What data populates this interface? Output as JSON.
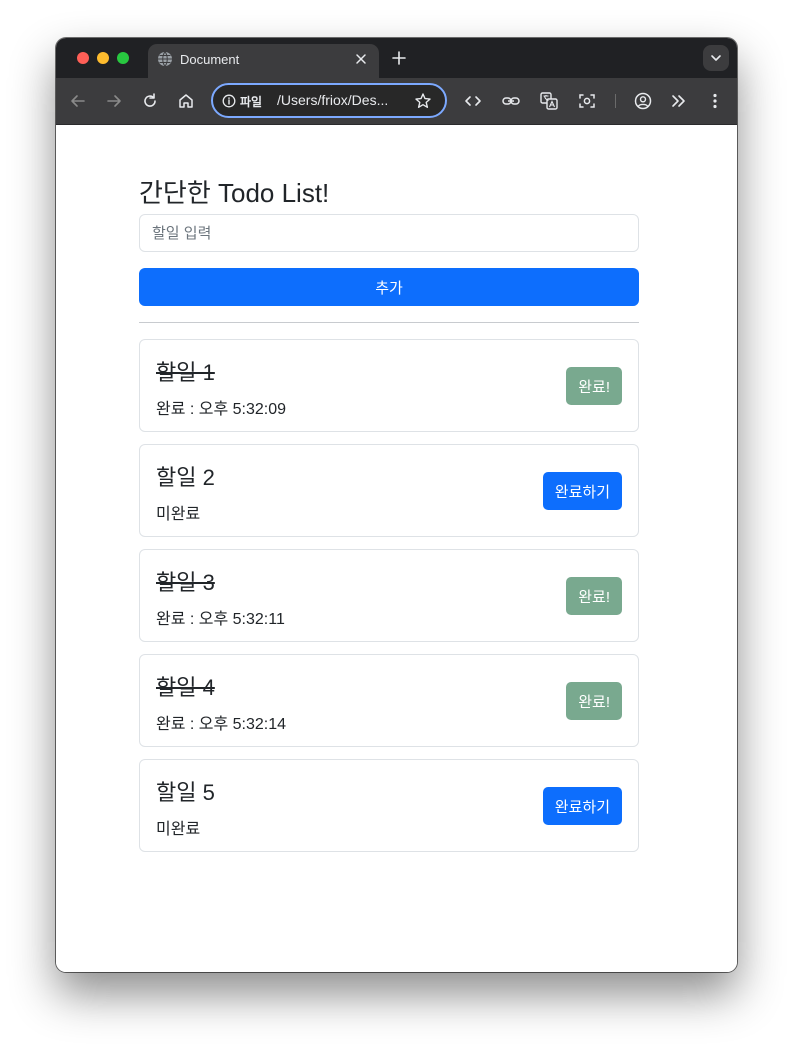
{
  "browser": {
    "tab_title": "Document",
    "omnibox_chip": "파일",
    "omnibox_url": "/Users/friox/Des..."
  },
  "page": {
    "title": "간단한 Todo List!",
    "input_placeholder": "할일 입력",
    "input_value": "",
    "add_button_label": "추가"
  },
  "todos": [
    {
      "title": "할일 1",
      "status": "완료 : 오후 5:32:09",
      "done": true,
      "button_label": "완료!"
    },
    {
      "title": "할일 2",
      "status": "미완료",
      "done": false,
      "button_label": "완료하기"
    },
    {
      "title": "할일 3",
      "status": "완료 : 오후 5:32:11",
      "done": true,
      "button_label": "완료!"
    },
    {
      "title": "할일 4",
      "status": "완료 : 오후 5:32:14",
      "done": true,
      "button_label": "완료!"
    },
    {
      "title": "할일 5",
      "status": "미완료",
      "done": false,
      "button_label": "완료하기"
    }
  ],
  "colors": {
    "primary": "#0d6efd",
    "done_button": "#79a98f",
    "browser_chrome": "#3c3c3e"
  }
}
